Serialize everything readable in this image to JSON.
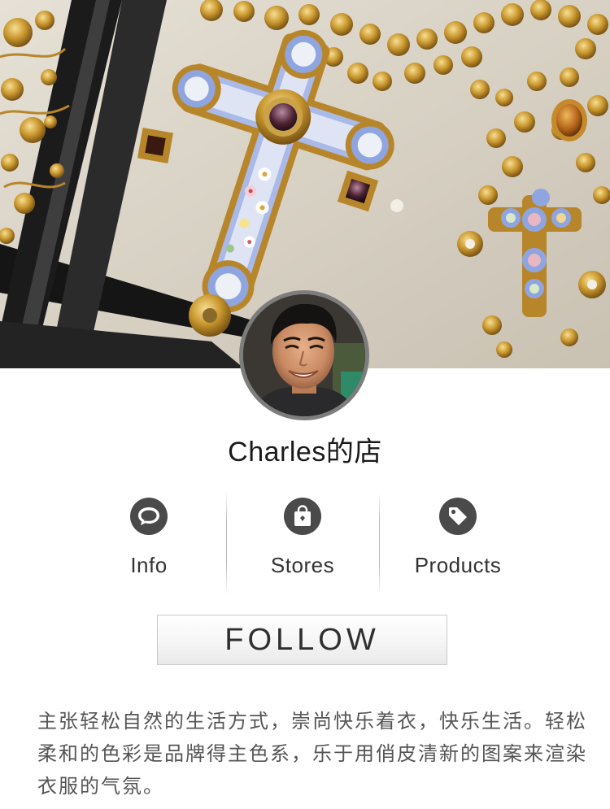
{
  "shop": {
    "name": "Charles的店"
  },
  "nav": {
    "items": [
      {
        "label": "Info",
        "icon": "chat-bubble-icon"
      },
      {
        "label": "Stores",
        "icon": "shopping-bag-icon"
      },
      {
        "label": "Products",
        "icon": "price-tag-icon"
      }
    ]
  },
  "follow": {
    "label": "FOLLOW"
  },
  "description": {
    "text": "主张轻松自然的生活方式，崇尚快乐着衣，快乐生活。轻松柔和的色彩是品牌得主色系，乐于用俏皮清新的图案来渲染衣服的气氛。"
  },
  "colors": {
    "icon_bg": "#4a4a4a",
    "text_primary": "#1a1a1a",
    "text_secondary": "#555555",
    "avatar_ring": "#7d7d7d",
    "gold": "#c9972e"
  }
}
